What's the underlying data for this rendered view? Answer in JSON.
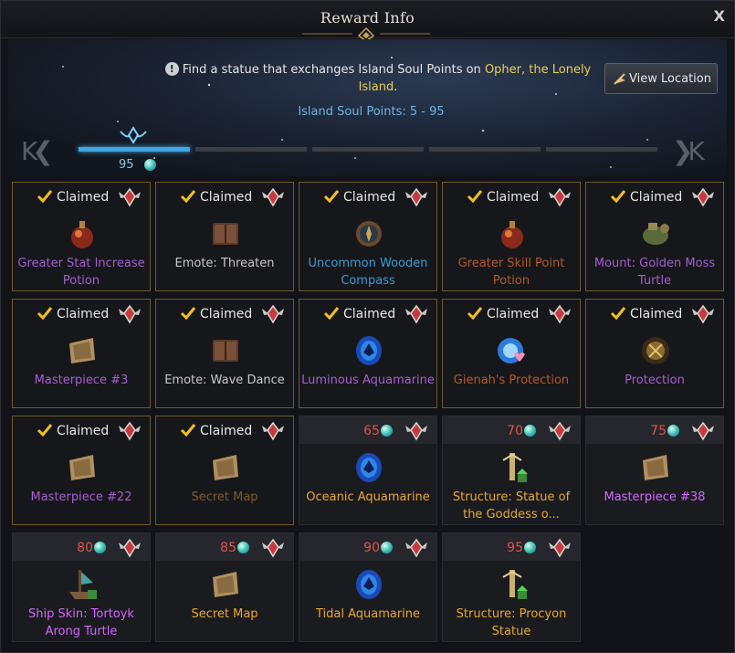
{
  "title": "Reward Info",
  "close_label": "X",
  "notice": {
    "text_before": "Find a statue that exchanges Island Soul Points on ",
    "location": "Opher, the Lonely Island",
    "text_after": "."
  },
  "view_location_label": "View Location",
  "points_range": "Island Soul Points: 5 - 95",
  "progress": {
    "current": "95",
    "pages": 5,
    "active_page": 1
  },
  "claimed_label": "Claimed",
  "colors": {
    "purple": "#a45ed1",
    "gray": "#bdbdbd",
    "blue": "#3a9bd8",
    "orange": "#c0702e",
    "red": "#e4534a",
    "gold": "#e8a92e",
    "brightpurple": "#d466ff"
  },
  "rewards": [
    {
      "name": "Greater Stat Increase Potion",
      "claimed": true,
      "color": "#a45ed1",
      "icon": "potion-icon"
    },
    {
      "name": "Emote: Threaten",
      "claimed": true,
      "color": "#c8c8c8",
      "icon": "book-icon"
    },
    {
      "name": "Uncommon Wooden Compass",
      "claimed": true,
      "color": "#3a9bd8",
      "icon": "compass-icon"
    },
    {
      "name": "Greater Skill Point Potion",
      "claimed": true,
      "color": "#b5592a",
      "icon": "potion-icon"
    },
    {
      "name": "Mount: Golden Moss Turtle",
      "claimed": true,
      "color": "#a45ed1",
      "icon": "turtle-icon"
    },
    {
      "name": "Masterpiece #3",
      "claimed": true,
      "color": "#a45ed1",
      "icon": "map-icon"
    },
    {
      "name": "Emote: Wave Dance",
      "claimed": true,
      "color": "#c8c8c8",
      "icon": "book-icon"
    },
    {
      "name": "Luminous Aquamarine",
      "claimed": true,
      "color": "#a45ed1",
      "icon": "gem-icon"
    },
    {
      "name": "Gienah's Protection",
      "claimed": true,
      "color": "#b5592a",
      "icon": "orb-icon"
    },
    {
      "name": "Protection",
      "claimed": true,
      "color": "#a45ed1",
      "icon": "rune-icon"
    },
    {
      "name": "Masterpiece #22",
      "claimed": true,
      "color": "#a45ed1",
      "icon": "map-icon"
    },
    {
      "name": "Secret Map",
      "claimed": true,
      "color": "#7d5a30",
      "icon": "map-icon"
    },
    {
      "name": "Oceanic Aquamarine",
      "claimed": false,
      "cost": "65",
      "color": "#e8a92e",
      "icon": "gem-icon"
    },
    {
      "name": "Structure: Statue of the Goddess o...",
      "claimed": false,
      "cost": "70",
      "color": "#e8a92e",
      "icon": "statue-icon"
    },
    {
      "name": "Masterpiece #38",
      "claimed": false,
      "cost": "75",
      "color": "#d466ff",
      "icon": "map-icon"
    },
    {
      "name": "Ship Skin: Tortoyk Arong Turtle",
      "claimed": false,
      "cost": "80",
      "color": "#d466ff",
      "icon": "ship-icon"
    },
    {
      "name": "Secret Map",
      "claimed": false,
      "cost": "85",
      "color": "#e8a92e",
      "icon": "map-icon"
    },
    {
      "name": "Tidal Aquamarine",
      "claimed": false,
      "cost": "90",
      "color": "#e8a92e",
      "icon": "gem-icon"
    },
    {
      "name": "Structure: Procyon Statue",
      "claimed": false,
      "cost": "95",
      "color": "#e8a92e",
      "icon": "statue-icon"
    }
  ]
}
